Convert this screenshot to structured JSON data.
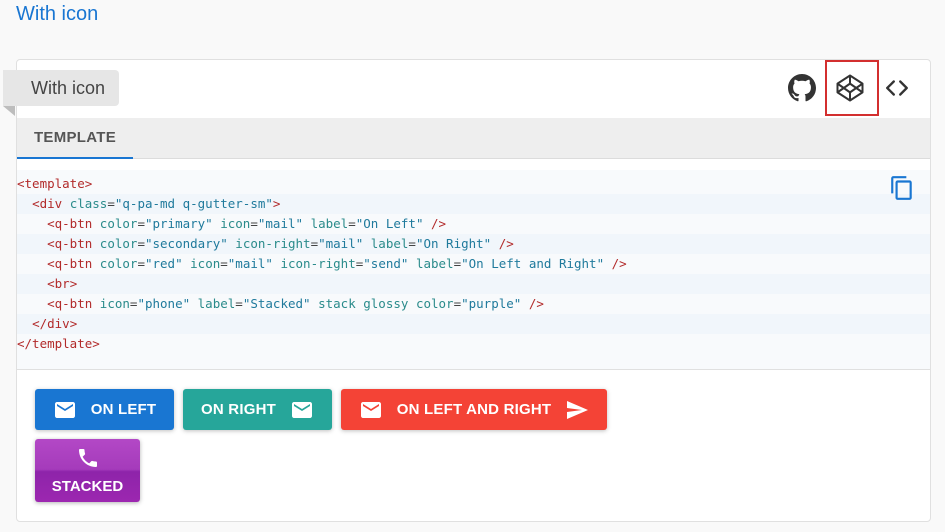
{
  "page": {
    "section_title": "With icon"
  },
  "card": {
    "ribbon_label": "With icon",
    "toolbar": {
      "icons": [
        "github-icon",
        "codepen-icon",
        "code-brackets-icon"
      ],
      "highlight_color": "#d32f2f"
    },
    "tabs": [
      {
        "label": "TEMPLATE",
        "active": true
      }
    ],
    "code_lines": [
      "<template>",
      "  <div class=\"q-pa-md q-gutter-sm\">",
      "    <q-btn color=\"primary\" icon=\"mail\" label=\"On Left\" />",
      "    <q-btn color=\"secondary\" icon-right=\"mail\" label=\"On Right\" />",
      "    <q-btn color=\"red\" icon=\"mail\" icon-right=\"send\" label=\"On Left and Right\" />",
      "    <br>",
      "    <q-btn icon=\"phone\" label=\"Stacked\" stack glossy color=\"purple\" />",
      "  </div>",
      "</template>"
    ],
    "copy_icon": "copy-icon"
  },
  "buttons": {
    "on_left": {
      "label": "ON LEFT",
      "color": "#1976d2",
      "icon": "mail-icon"
    },
    "on_right": {
      "label": "ON RIGHT",
      "color": "#26a69a",
      "icon": "mail-icon"
    },
    "on_left_and_right": {
      "label": "ON LEFT AND RIGHT",
      "color": "#f44336",
      "icon_left": "mail-icon",
      "icon_right": "send-icon"
    },
    "stacked": {
      "label": "STACKED",
      "color": "#9c27b0",
      "icon": "phone-icon"
    }
  }
}
